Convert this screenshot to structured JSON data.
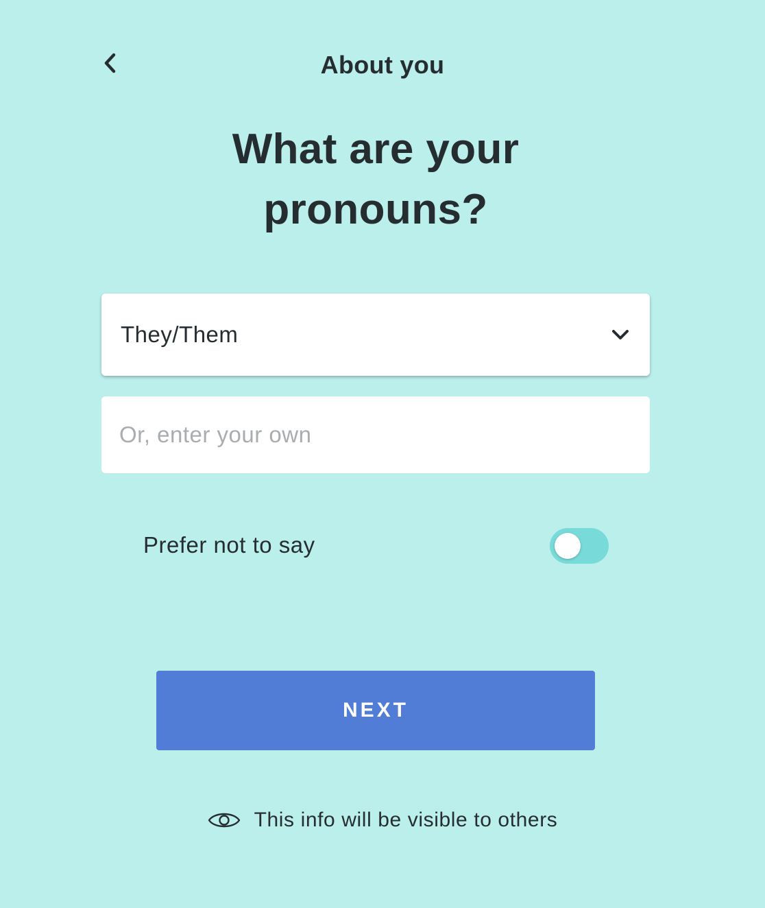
{
  "header": {
    "title": "About you",
    "back_icon": "chevron-left-icon"
  },
  "question": {
    "line1": "What are your",
    "line2": "pronouns?"
  },
  "pronoun_select": {
    "selected_value": "They/Them",
    "icon": "chevron-down-icon"
  },
  "custom_input": {
    "value": "",
    "placeholder": "Or, enter your own"
  },
  "prefer_not_to_say": {
    "label": "Prefer not to say",
    "checked": false
  },
  "next_button": {
    "label": "NEXT"
  },
  "visibility_note": {
    "icon": "eye-icon",
    "text": "This info will be visible to others"
  },
  "colors": {
    "background": "#bbefec",
    "text": "#262d31",
    "accent_button": "#527dd6",
    "toggle_track": "#78dad9",
    "placeholder": "#a9adaf"
  }
}
